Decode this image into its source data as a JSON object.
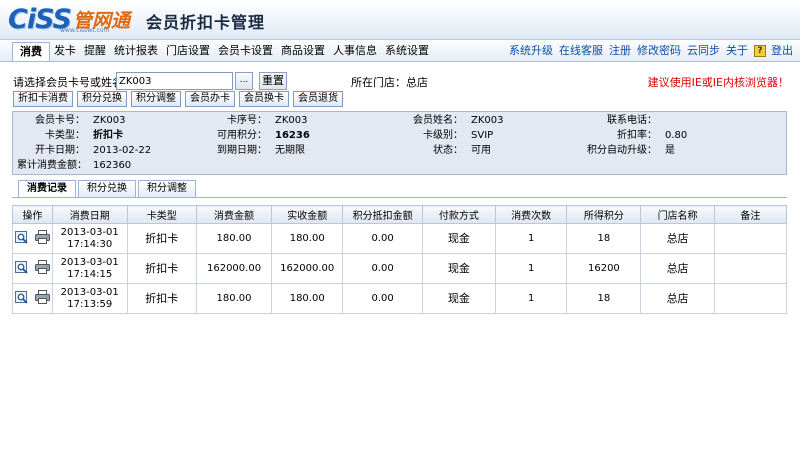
{
  "header": {
    "logo_text": "CiSS",
    "logo_cn": "管网通",
    "logo_url": "www.cisswt.com",
    "title": "会员折扣卡管理"
  },
  "menu": {
    "items": [
      "消费",
      "发卡",
      "提醒",
      "统计报表",
      "门店设置",
      "会员卡设置",
      "商品设置",
      "人事信息",
      "系统设置"
    ],
    "active_index": 0,
    "right_links": [
      "系统升级",
      "在线客服",
      "注册",
      "修改密码",
      "云同步",
      "关于"
    ],
    "help_glyph": "?",
    "logout": "登出"
  },
  "search": {
    "label": "请选择会员卡号或姓名",
    "value": "ZK003",
    "dots_label": "...",
    "reset_label": "重置",
    "store_label": "所在门店：总店",
    "browser_warning": "建议使用IE或IE内核浏览器！"
  },
  "actions": [
    "折扣卡消费",
    "积分兑换",
    "积分调整",
    "会员办卡",
    "会员换卡",
    "会员退货"
  ],
  "card_info": {
    "card_no_label": "会员卡号：",
    "card_no": "ZK003",
    "seq_label": "卡序号：",
    "seq": "ZK003",
    "name_label": "会员姓名：",
    "name": "ZK003",
    "phone_label": "联系电话：",
    "phone": "",
    "type_label": "卡类型：",
    "type": "折扣卡",
    "points_label": "可用积分：",
    "points": "16236",
    "level_label": "卡级别：",
    "level": "SVIP",
    "discount_label": "折扣率：",
    "discount": "0.80",
    "open_label": "开卡日期：",
    "open_date": "2013-02-22",
    "expire_label": "到期日期：",
    "expire": "无期限",
    "status_label": "状态：",
    "status": "可用",
    "auto_label": "积分自动升级：",
    "auto": "是",
    "total_label": "累计消费金额：",
    "total": "162360"
  },
  "tabs": [
    "消费记录",
    "积分兑换",
    "积分调整"
  ],
  "table": {
    "columns": [
      "操作",
      "消费日期",
      "卡类型",
      "消费金额",
      "实收金额",
      "积分抵扣金额",
      "付款方式",
      "消费次数",
      "所得积分",
      "门店名称",
      "备注"
    ],
    "rows": [
      {
        "date": "2013-03-01",
        "time": "17:14:30",
        "type": "折扣卡",
        "amount": "180.00",
        "received": "180.00",
        "deduct": "0.00",
        "pay": "现金",
        "count": "1",
        "points": "18",
        "store": "总店",
        "note": ""
      },
      {
        "date": "2013-03-01",
        "time": "17:14:15",
        "type": "折扣卡",
        "amount": "162000.00",
        "received": "162000.00",
        "deduct": "0.00",
        "pay": "现金",
        "count": "1",
        "points": "16200",
        "store": "总店",
        "note": ""
      },
      {
        "date": "2013-03-01",
        "time": "17:13:59",
        "type": "折扣卡",
        "amount": "180.00",
        "received": "180.00",
        "deduct": "0.00",
        "pay": "现金",
        "count": "1",
        "points": "18",
        "store": "总店",
        "note": ""
      }
    ],
    "row_icons": [
      "view-icon",
      "print-icon"
    ]
  },
  "colors": {
    "brand_blue": "#1d62b8",
    "brand_orange": "#e06a10",
    "link": "#0a4fa8",
    "warning": "#e00000",
    "panel": "#e3e9f2"
  }
}
